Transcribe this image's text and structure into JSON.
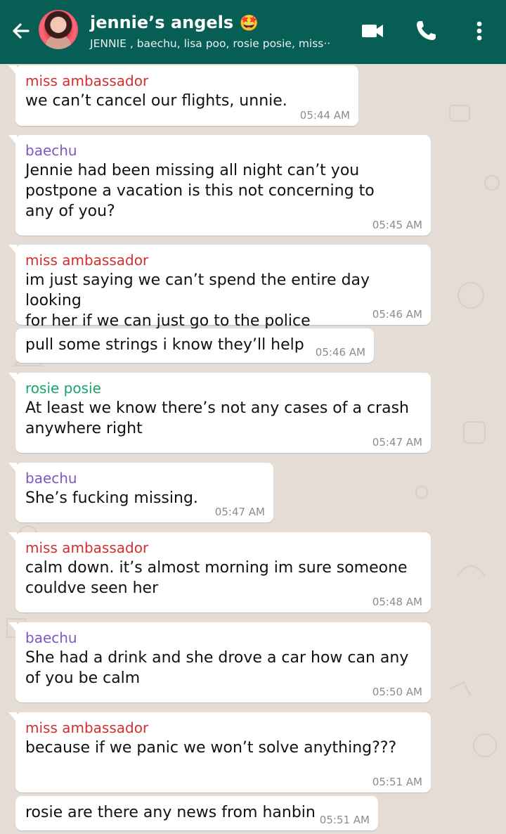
{
  "header": {
    "title": "jennie’s angels",
    "title_emoji": "🤩",
    "subtitle": "JENNIE , baechu, lisa poo, rosie posie, miss··",
    "back_icon": "arrow-left-icon",
    "video_icon": "video-call-icon",
    "call_icon": "phone-icon",
    "menu_icon": "more-vertical-icon",
    "colors": {
      "bar": "#075e54",
      "text": "#ffffff"
    }
  },
  "chat": {
    "background": "#e5ddd5",
    "sender_colors": {
      "miss ambassador": "#d32f2f",
      "baechu": "#7e57c2",
      "rosie posie": "#1aa46b"
    },
    "messages": [
      {
        "sender": "miss ambassador",
        "text": "we can’t cancel our flights, unnie.",
        "time": "05:44 AM"
      },
      {
        "sender": "baechu",
        "text": "Jennie had been missing all night can’t you\npostpone a vacation is this not concerning to\nany of you?",
        "time": "05:45 AM"
      },
      {
        "sender": "miss ambassador",
        "text": "im just saying we can’t spend the entire day looking\nfor her if we can just go to the police",
        "time": "05:46 AM"
      },
      {
        "sender": "",
        "text": "pull some strings i know they’ll help",
        "time": "05:46 AM"
      },
      {
        "sender": "rosie posie",
        "text": "At least we know there’s not any cases of a crash\nanywhere right",
        "time": "05:47 AM"
      },
      {
        "sender": "baechu",
        "text": "She’s fucking missing.",
        "time": "05:47 AM"
      },
      {
        "sender": "miss ambassador",
        "text": "calm down. it’s almost morning im sure someone\ncouldve seen her",
        "time": "05:48 AM"
      },
      {
        "sender": "baechu",
        "text": "She had a drink and she drove a car how can any\nof you be calm",
        "time": "05:50 AM"
      },
      {
        "sender": "miss ambassador",
        "text": "because if we panic we won’t solve anything???",
        "time": "05:51 AM"
      },
      {
        "sender": "",
        "text": "rosie are there any news from hanbin",
        "time": "05:51 AM"
      }
    ]
  }
}
